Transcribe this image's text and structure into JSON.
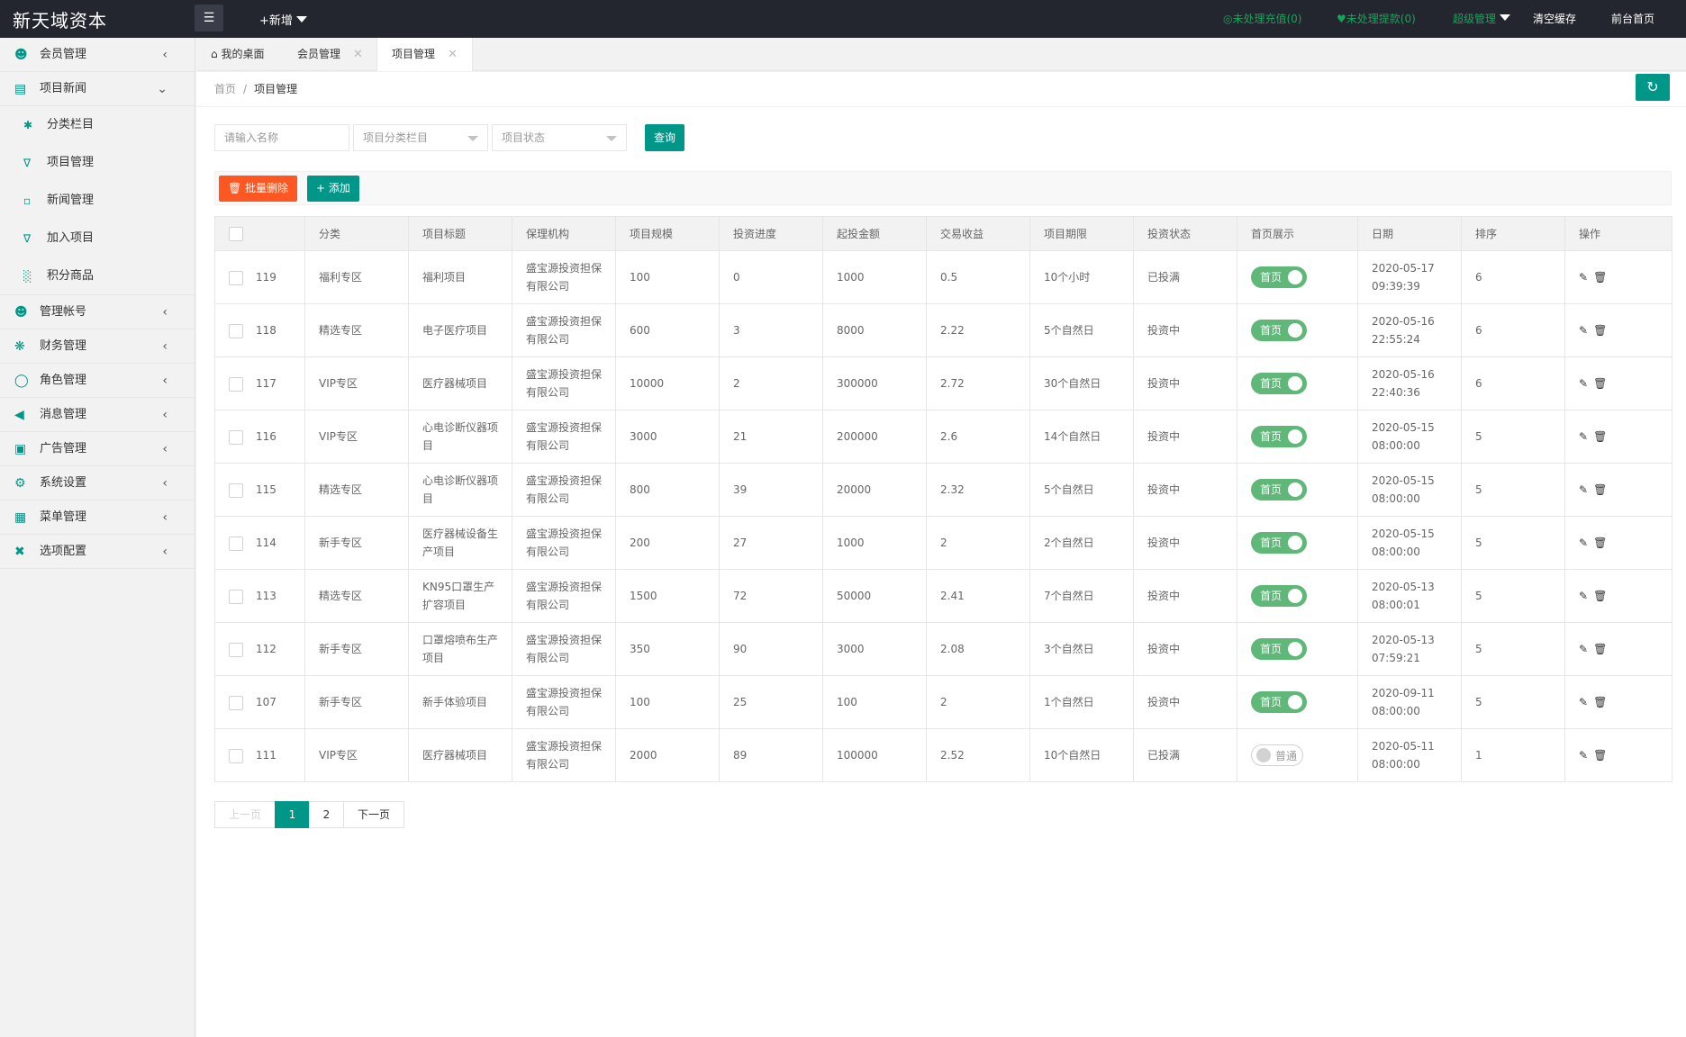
{
  "header": {
    "logo": "新天域资本",
    "menu_toggle_icon": "☰",
    "new_add": "+新增",
    "unprocessed_recharge": "◎未处理充值(0)",
    "unprocessed_withdraw": "♥未处理提款(0)",
    "super_admin": "超级管理",
    "clear_cache": "清空缓存",
    "front_home": "前台首页"
  },
  "sidebar": {
    "items": [
      {
        "label": "会员管理",
        "icon": "user-icon"
      },
      {
        "label": "项目新闻",
        "icon": "news-icon",
        "expanded": true
      },
      {
        "label": "管理帐号",
        "icon": "users-icon"
      },
      {
        "label": "财务管理",
        "icon": "finance-icon"
      },
      {
        "label": "角色管理",
        "icon": "shield-icon"
      },
      {
        "label": "消息管理",
        "icon": "message-icon"
      },
      {
        "label": "广告管理",
        "icon": "ad-icon"
      },
      {
        "label": "系统设置",
        "icon": "gear-icon"
      },
      {
        "label": "菜单管理",
        "icon": "menu-icon"
      },
      {
        "label": "选项配置",
        "icon": "option-icon"
      }
    ],
    "sub_items": [
      {
        "label": "分类栏目",
        "icon": "tree-icon"
      },
      {
        "label": "项目管理",
        "icon": "cart-icon"
      },
      {
        "label": "新闻管理",
        "icon": "doc-icon"
      },
      {
        "label": "加入项目",
        "icon": "cart-icon"
      },
      {
        "label": "积分商品",
        "icon": "chart-icon"
      }
    ]
  },
  "tabs": [
    {
      "label": "我的桌面",
      "icon": "home-icon"
    },
    {
      "label": "会员管理"
    },
    {
      "label": "项目管理",
      "active": true
    }
  ],
  "breadcrumb": {
    "home": "首页",
    "sep": "/",
    "current": "项目管理"
  },
  "search": {
    "name_placeholder": "请输入名称",
    "category_placeholder": "项目分类栏目",
    "status_placeholder": "项目状态",
    "query_label": "查询"
  },
  "toolbar": {
    "batch_delete": "🗑 批量删除",
    "add": "+ 添加"
  },
  "table": {
    "headers": [
      "分类",
      "项目标题",
      "保理机构",
      "项目规模",
      "投资进度",
      "起投金额",
      "交易收益",
      "项目期限",
      "投资状态",
      "首页展示",
      "日期",
      "排序",
      "操作"
    ],
    "rows": [
      {
        "id": "119",
        "category": "福利专区",
        "title": "福利项目",
        "org": "盛宝源投资担保有限公司",
        "scale": "100",
        "progress": "0",
        "min": "1000",
        "yield": "0.5",
        "term": "10个小时",
        "status": "已投满",
        "home_label": "首页",
        "home_on": true,
        "date": "2020-05-17 09:39:39",
        "sort": "6"
      },
      {
        "id": "118",
        "category": "精选专区",
        "title": "电子医疗项目",
        "org": "盛宝源投资担保有限公司",
        "scale": "600",
        "progress": "3",
        "min": "8000",
        "yield": "2.22",
        "term": "5个自然日",
        "status": "投资中",
        "home_label": "首页",
        "home_on": true,
        "date": "2020-05-16 22:55:24",
        "sort": "6"
      },
      {
        "id": "117",
        "category": "VIP专区",
        "title": "医疗器械项目",
        "org": "盛宝源投资担保有限公司",
        "scale": "10000",
        "progress": "2",
        "min": "300000",
        "yield": "2.72",
        "term": "30个自然日",
        "status": "投资中",
        "home_label": "首页",
        "home_on": true,
        "date": "2020-05-16 22:40:36",
        "sort": "6"
      },
      {
        "id": "116",
        "category": "VIP专区",
        "title": "心电诊断仪器项目",
        "org": "盛宝源投资担保有限公司",
        "scale": "3000",
        "progress": "21",
        "min": "200000",
        "yield": "2.6",
        "term": "14个自然日",
        "status": "投资中",
        "home_label": "首页",
        "home_on": true,
        "date": "2020-05-15 08:00:00",
        "sort": "5"
      },
      {
        "id": "115",
        "category": "精选专区",
        "title": "心电诊断仪器项目",
        "org": "盛宝源投资担保有限公司",
        "scale": "800",
        "progress": "39",
        "min": "20000",
        "yield": "2.32",
        "term": "5个自然日",
        "status": "投资中",
        "home_label": "首页",
        "home_on": true,
        "date": "2020-05-15 08:00:00",
        "sort": "5"
      },
      {
        "id": "114",
        "category": "新手专区",
        "title": "医疗器械设备生产项目",
        "org": "盛宝源投资担保有限公司",
        "scale": "200",
        "progress": "27",
        "min": "1000",
        "yield": "2",
        "term": "2个自然日",
        "status": "投资中",
        "home_label": "首页",
        "home_on": true,
        "date": "2020-05-15 08:00:00",
        "sort": "5"
      },
      {
        "id": "113",
        "category": "精选专区",
        "title": "KN95口罩生产扩容项目",
        "org": "盛宝源投资担保有限公司",
        "scale": "1500",
        "progress": "72",
        "min": "50000",
        "yield": "2.41",
        "term": "7个自然日",
        "status": "投资中",
        "home_label": "首页",
        "home_on": true,
        "date": "2020-05-13 08:00:01",
        "sort": "5"
      },
      {
        "id": "112",
        "category": "新手专区",
        "title": "口罩熔喷布生产项目",
        "org": "盛宝源投资担保有限公司",
        "scale": "350",
        "progress": "90",
        "min": "3000",
        "yield": "2.08",
        "term": "3个自然日",
        "status": "投资中",
        "home_label": "首页",
        "home_on": true,
        "date": "2020-05-13 07:59:21",
        "sort": "5"
      },
      {
        "id": "107",
        "category": "新手专区",
        "title": "新手体验项目",
        "org": "盛宝源投资担保有限公司",
        "scale": "100",
        "progress": "25",
        "min": "100",
        "yield": "2",
        "term": "1个自然日",
        "status": "投资中",
        "home_label": "首页",
        "home_on": true,
        "date": "2020-09-11 08:00:00",
        "sort": "5"
      },
      {
        "id": "111",
        "category": "VIP专区",
        "title": "医疗器械项目",
        "org": "盛宝源投资担保有限公司",
        "scale": "2000",
        "progress": "89",
        "min": "100000",
        "yield": "2.52",
        "term": "10个自然日",
        "status": "已投满",
        "home_label": "普通",
        "home_on": false,
        "date": "2020-05-11 08:00:00",
        "sort": "1"
      }
    ]
  },
  "pagination": {
    "prev": "上一页",
    "pages": [
      "1",
      "2"
    ],
    "current": "1",
    "next": "下一页"
  },
  "colors": {
    "accent": "#009688",
    "danger": "#ff5722",
    "switch_on": "#5fb878",
    "topbar": "#23262e"
  }
}
